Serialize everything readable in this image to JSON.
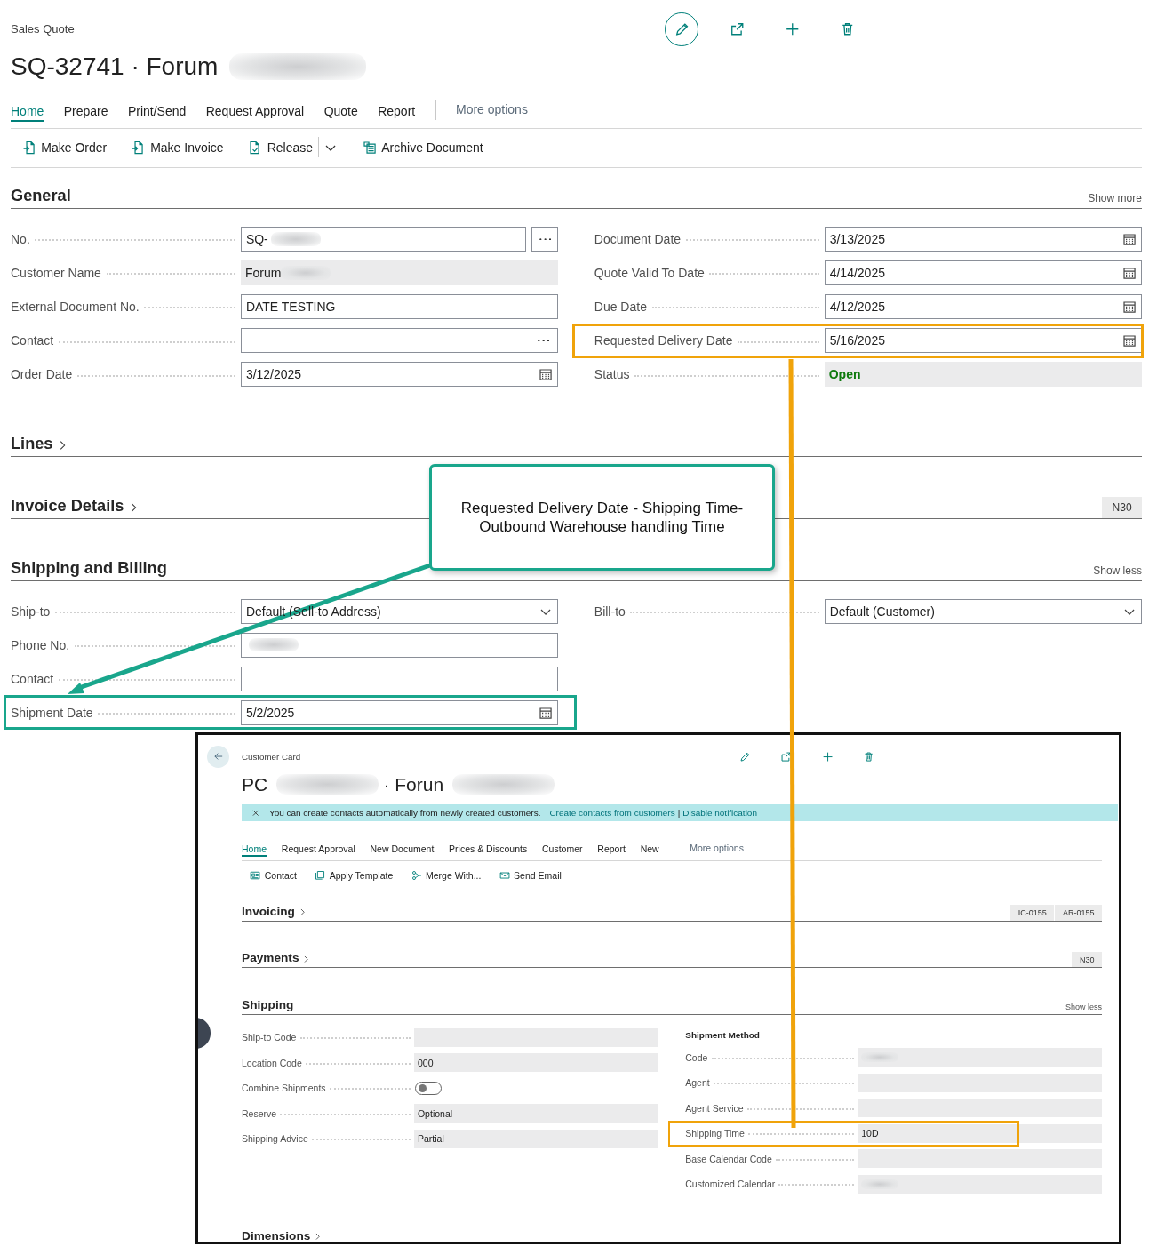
{
  "breadcrumb": "Sales Quote",
  "title_parts": [
    {
      "kind": "text",
      "text": "SQ-32741 · Forum"
    },
    {
      "kind": "redacted"
    }
  ],
  "tabs": [
    {
      "label": "Home",
      "selected": true
    },
    {
      "label": "Prepare",
      "selected": false
    },
    {
      "label": "Print/Send",
      "selected": false
    },
    {
      "label": "Request Approval",
      "selected": false
    },
    {
      "label": "Quote",
      "selected": false
    },
    {
      "label": "Report",
      "selected": false
    }
  ],
  "more_options": "More options",
  "actions": [
    {
      "label": "Make Order",
      "dropdown": false
    },
    {
      "label": "Make Invoice",
      "dropdown": false
    },
    {
      "label": "Release",
      "dropdown": true
    },
    {
      "label": "Archive Document",
      "dropdown": false
    }
  ],
  "sections": [
    {
      "title": "General",
      "collapsed": false,
      "toggle": "Show more",
      "left": [
        {
          "label": "No.",
          "kind": "lookup",
          "value": "SQ-",
          "redacted": true
        },
        {
          "label": "Customer Name",
          "kind": "readonly",
          "value": "Forum",
          "redacted": true
        },
        {
          "label": "External Document No.",
          "kind": "text",
          "value": "DATE TESTING"
        },
        {
          "label": "Contact",
          "kind": "assist"
        },
        {
          "label": "Order Date",
          "kind": "date",
          "value": "3/12/2025"
        }
      ],
      "right": [
        {
          "label": "Document Date",
          "kind": "date",
          "value": "3/13/2025"
        },
        {
          "label": "Quote Valid To Date",
          "kind": "date",
          "value": "4/14/2025"
        },
        {
          "label": "Due Date",
          "kind": "date",
          "value": "4/12/2025"
        },
        {
          "label": "Requested Delivery Date",
          "kind": "date",
          "value": "5/16/2025",
          "highlight": true,
          "color": "#f0a30a"
        },
        {
          "label": "Status",
          "kind": "status",
          "value": "Open"
        }
      ]
    },
    {
      "title": "Lines",
      "collapsed": true
    },
    {
      "title": "Invoice Details",
      "collapsed": true,
      "badges": [
        "N30"
      ]
    },
    {
      "title": "Shipping and Billing",
      "collapsed": false,
      "toggle": "Show less",
      "left": [
        {
          "label": "Ship-to",
          "kind": "select",
          "value": "Default (Sell-to Address)"
        },
        {
          "label": "Phone No.",
          "kind": "text",
          "redacted": true
        },
        {
          "label": "Contact",
          "kind": "text"
        },
        {
          "label": "Shipment Date",
          "kind": "date",
          "value": "5/2/2025",
          "highlight": true,
          "color": "#19a68c"
        }
      ],
      "right": [
        {
          "label": "Bill-to",
          "kind": "select",
          "value": "Default (Customer)"
        }
      ]
    }
  ],
  "callout": {
    "lines": [
      "Requested Delivery Date - Shipping Time-",
      "Outbound Warehouse handling Time"
    ]
  },
  "inset": {
    "breadcrumb": "Customer Card",
    "title_parts": [
      {
        "kind": "text",
        "text": "PC"
      },
      {
        "kind": "redacted"
      },
      {
        "kind": "text",
        "text": "· Forun"
      },
      {
        "kind": "redacted"
      }
    ],
    "notification": [
      {
        "kind": "message",
        "text": "You can create contacts automatically from newly created customers."
      },
      {
        "kind": "link",
        "text": "Create contacts from customers"
      },
      {
        "kind": "separator",
        "text": "|"
      },
      {
        "kind": "link",
        "text": "Disable notification"
      }
    ],
    "tabs": [
      {
        "label": "Home",
        "selected": true
      },
      {
        "label": "Request Approval",
        "selected": false
      },
      {
        "label": "New Document",
        "selected": false
      },
      {
        "label": "Prices & Discounts",
        "selected": false
      },
      {
        "label": "Customer",
        "selected": false
      },
      {
        "label": "Report",
        "selected": false
      },
      {
        "label": "New",
        "selected": false
      }
    ],
    "more_options": "More options",
    "actions": [
      {
        "label": "Contact",
        "dropdown": false
      },
      {
        "label": "Apply Template",
        "dropdown": false
      },
      {
        "label": "Merge With...",
        "dropdown": false
      },
      {
        "label": "Send Email",
        "dropdown": false
      }
    ],
    "sections": [
      {
        "title": "Invoicing",
        "collapsed": true,
        "badges": [
          "IC-0155",
          "AR-0155"
        ]
      },
      {
        "title": "Payments",
        "collapsed": true,
        "badges": [
          "N30"
        ]
      },
      {
        "title": "Shipping",
        "collapsed": false,
        "toggle": "Show less",
        "left": [
          {
            "label": "Ship-to Code",
            "kind": "readonly"
          },
          {
            "label": "Location Code",
            "kind": "readonly",
            "value": "000"
          },
          {
            "label": "Combine Shipments",
            "kind": "toggle",
            "on": false
          },
          {
            "label": "Reserve",
            "kind": "readonly",
            "value": "Optional"
          },
          {
            "label": "Shipping Advice",
            "kind": "readonly",
            "value": "Partial"
          }
        ],
        "right_heading": "Shipment Method",
        "right": [
          {
            "label": "Code",
            "kind": "readonly",
            "redacted": true
          },
          {
            "label": "Agent",
            "kind": "readonly"
          },
          {
            "label": "Agent Service",
            "kind": "readonly"
          },
          {
            "label": "Shipping Time",
            "kind": "readonly",
            "value": "10D",
            "highlight": true,
            "color": "#f0a30a"
          },
          {
            "label": "Base Calendar Code",
            "kind": "readonly"
          },
          {
            "label": "Customized Calendar",
            "kind": "readonly",
            "redacted": true
          }
        ]
      },
      {
        "title": "Dimensions",
        "collapsed": true
      }
    ]
  }
}
